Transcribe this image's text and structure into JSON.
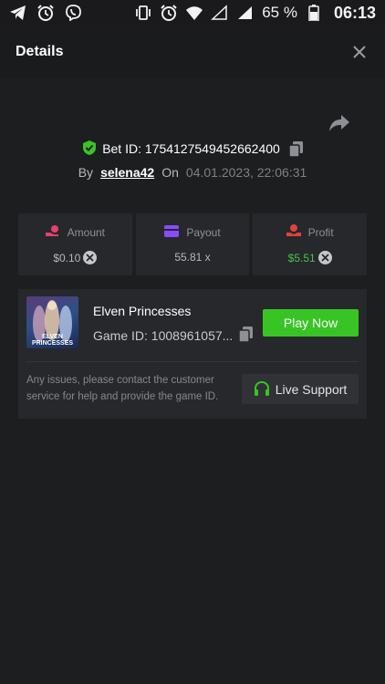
{
  "status_bar": {
    "battery": "65 %",
    "time": "06:13",
    "left_icons": [
      "telegram-icon",
      "alarm-icon",
      "viber-icon"
    ],
    "right_icons": [
      "vibrate-icon",
      "alarm-icon",
      "wifi-icon",
      "signal-icon",
      "signal-icon",
      "battery-icon"
    ]
  },
  "header": {
    "title": "Details"
  },
  "bet": {
    "label": "Bet ID: 1754127549452662400",
    "by_label": "By",
    "username": "selena42",
    "on_label": "On",
    "datetime": "04.01.2023, 22:06:31"
  },
  "stats": {
    "amount": {
      "label": "Amount",
      "value": "$0.10"
    },
    "payout": {
      "label": "Payout",
      "value": "55.81 x"
    },
    "profit": {
      "label": "Profit",
      "value": "$5.51"
    }
  },
  "game": {
    "thumb_title": "ELVEN PRINCESSES",
    "name": "Elven Princesses",
    "game_id": "Game ID: 1008961057...",
    "play_label": "Play Now"
  },
  "support": {
    "text": "Any issues, please contact the customer service for help and provide the game ID.",
    "button_label": "Live Support"
  },
  "colors": {
    "accent_green": "#39c425",
    "profit_green": "#4cc14b",
    "amount_icon": "#e8406c",
    "payout_icon": "#8a4bff",
    "profit_icon": "#e0433c"
  }
}
